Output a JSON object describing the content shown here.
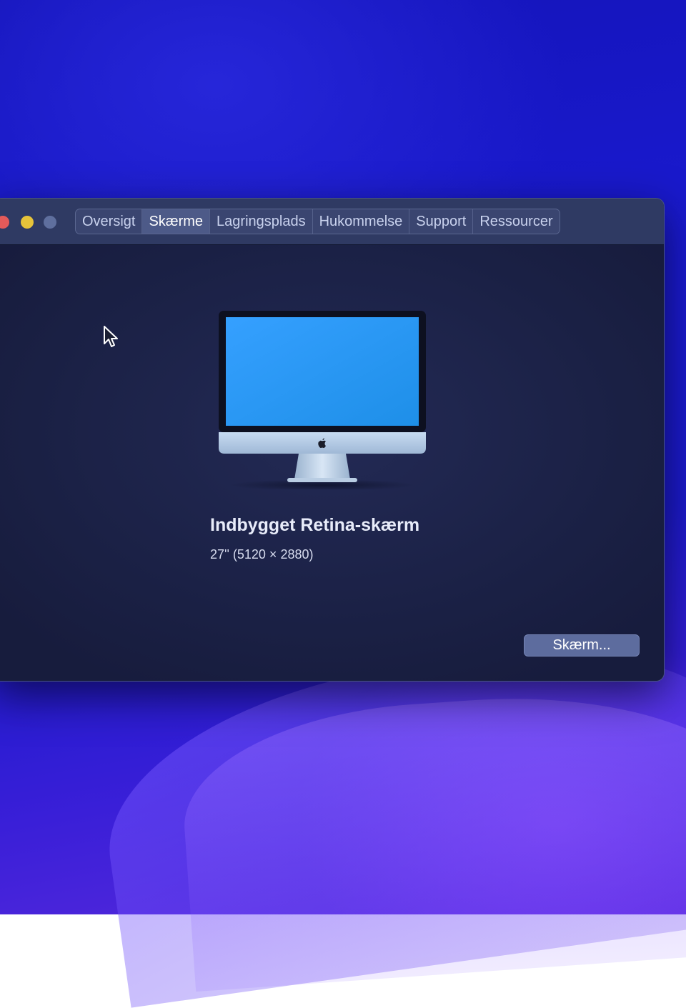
{
  "window": {
    "tabs": [
      {
        "label": "Oversigt",
        "active": false
      },
      {
        "label": "Skærme",
        "active": true
      },
      {
        "label": "Lagringsplads",
        "active": false
      },
      {
        "label": "Hukommelse",
        "active": false
      },
      {
        "label": "Support",
        "active": false
      },
      {
        "label": "Ressourcer",
        "active": false
      }
    ]
  },
  "display": {
    "name": "Indbygget Retina-skærm",
    "size": "27'' (5120 × 2880)",
    "button_label": "Skærm..."
  },
  "colors": {
    "desktop_blue": "#1a1ad0",
    "window_bg": "#1c2247",
    "titlebar": "#2f3a63",
    "traffic_close": "#e45a5a",
    "traffic_min": "#e6c33a",
    "traffic_zoom": "#5f6f9e"
  },
  "icons": [
    "traffic-light-close",
    "traffic-light-minimize",
    "traffic-light-zoom",
    "mouse-pointer-icon",
    "imac-display-icon",
    "apple-logo-icon"
  ]
}
